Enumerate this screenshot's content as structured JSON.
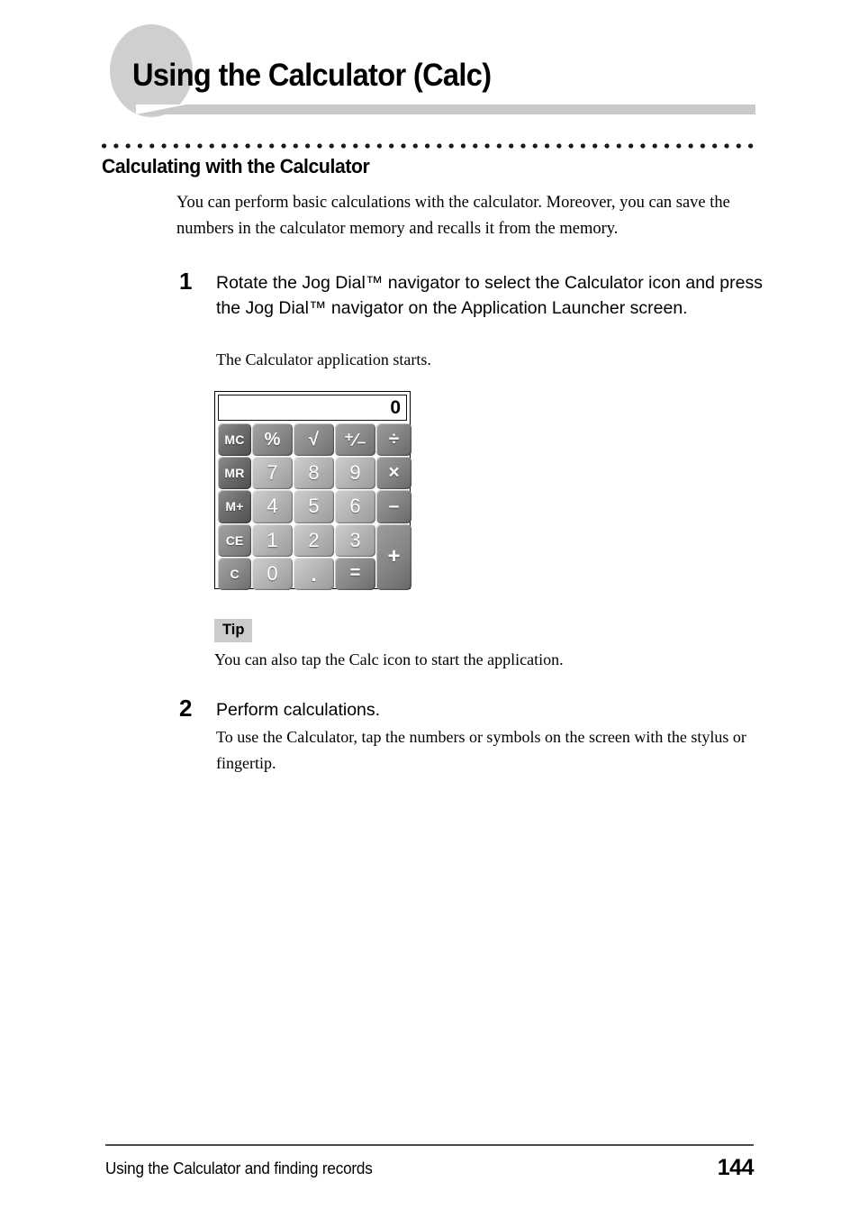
{
  "header": {
    "title": "Using the Calculator (Calc)"
  },
  "section": {
    "title": "Calculating with the Calculator",
    "intro": "You can perform basic calculations with the calculator. Moreover, you can save the numbers in the calculator memory and recalls it from the memory."
  },
  "steps": [
    {
      "number": "1",
      "heading": "Rotate the Jog Dial™ navigator to select the Calculator icon and press the Jog Dial™ navigator on the Application Launcher screen.",
      "body": "The Calculator application starts."
    },
    {
      "number": "2",
      "heading": "Perform calculations.",
      "body": "To use the Calculator, tap the numbers or symbols on the screen with the stylus or fingertip."
    }
  ],
  "calculator": {
    "display_value": "0",
    "keys": {
      "mc": "MC",
      "percent": "%",
      "sqrt": "√",
      "plusminus": "⁺⁄₋",
      "divide": "÷",
      "mr": "MR",
      "seven": "7",
      "eight": "8",
      "nine": "9",
      "multiply": "×",
      "mplus": "M+",
      "four": "4",
      "five": "5",
      "six": "6",
      "minus": "–",
      "ce": "CE",
      "one": "1",
      "two": "2",
      "three": "3",
      "plus": "+",
      "c": "C",
      "zero": "0",
      "decimal": ".",
      "equals": "="
    }
  },
  "tip": {
    "label": "Tip",
    "text": "You can also tap the Calc icon to start the application."
  },
  "footer": {
    "left": "Using the Calculator and finding records",
    "page": "144"
  },
  "colors": {
    "header_ellipse": "#cfcfcf",
    "header_bar": "#c9c9c9",
    "tip_badge_bg": "#cbcbcb",
    "footer_rule": "#4a4a4a",
    "text": "#000000"
  }
}
